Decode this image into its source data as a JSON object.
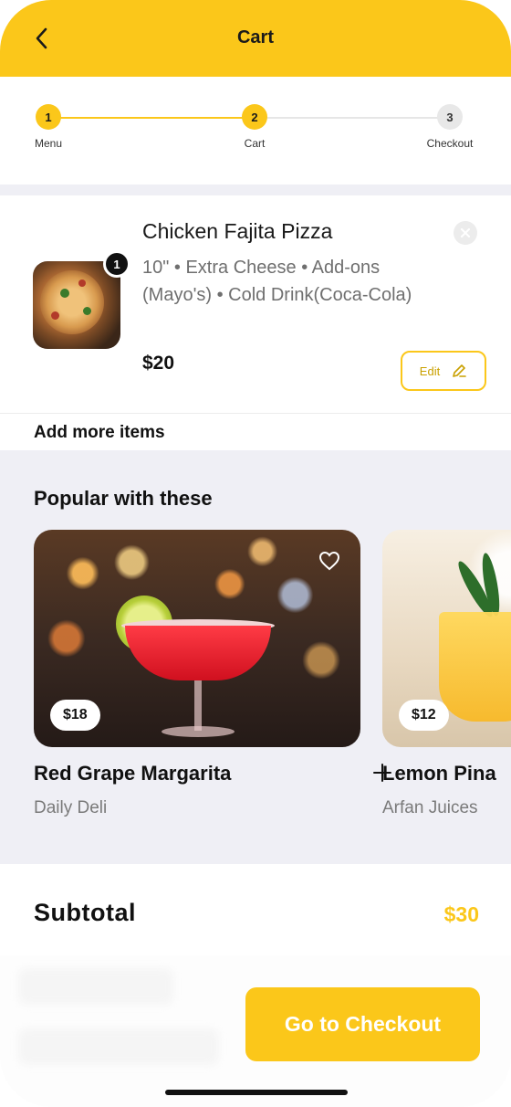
{
  "header": {
    "title": "Cart",
    "back_icon": "chevron-left-icon"
  },
  "stepper": {
    "steps": [
      {
        "number": "1",
        "label": "Menu",
        "state": "complete"
      },
      {
        "number": "2",
        "label": "Cart",
        "state": "current"
      },
      {
        "number": "3",
        "label": "Checkout",
        "state": "upcoming"
      }
    ]
  },
  "cart": {
    "items": [
      {
        "name": "Chicken Fajita Pizza",
        "description": "10\" • Extra Cheese • Add-ons (Mayo's) • Cold Drink(Coca-Cola)",
        "quantity": "1",
        "price": "$20",
        "edit_label": "Edit"
      }
    ],
    "add_more_label": "Add more items"
  },
  "popular": {
    "title": "Popular with these",
    "items": [
      {
        "name": "Red Grape Margarita",
        "vendor": "Daily Deli",
        "price": "$18"
      },
      {
        "name": "Lemon Pina",
        "vendor": "Arfan Juices",
        "price": "$12"
      }
    ]
  },
  "summary": {
    "subtotal_label": "Subtotal",
    "subtotal_value": "$30"
  },
  "checkout_button": "Go to Checkout",
  "colors": {
    "accent": "#FBC71A",
    "background_band": "#EFEFF5"
  }
}
